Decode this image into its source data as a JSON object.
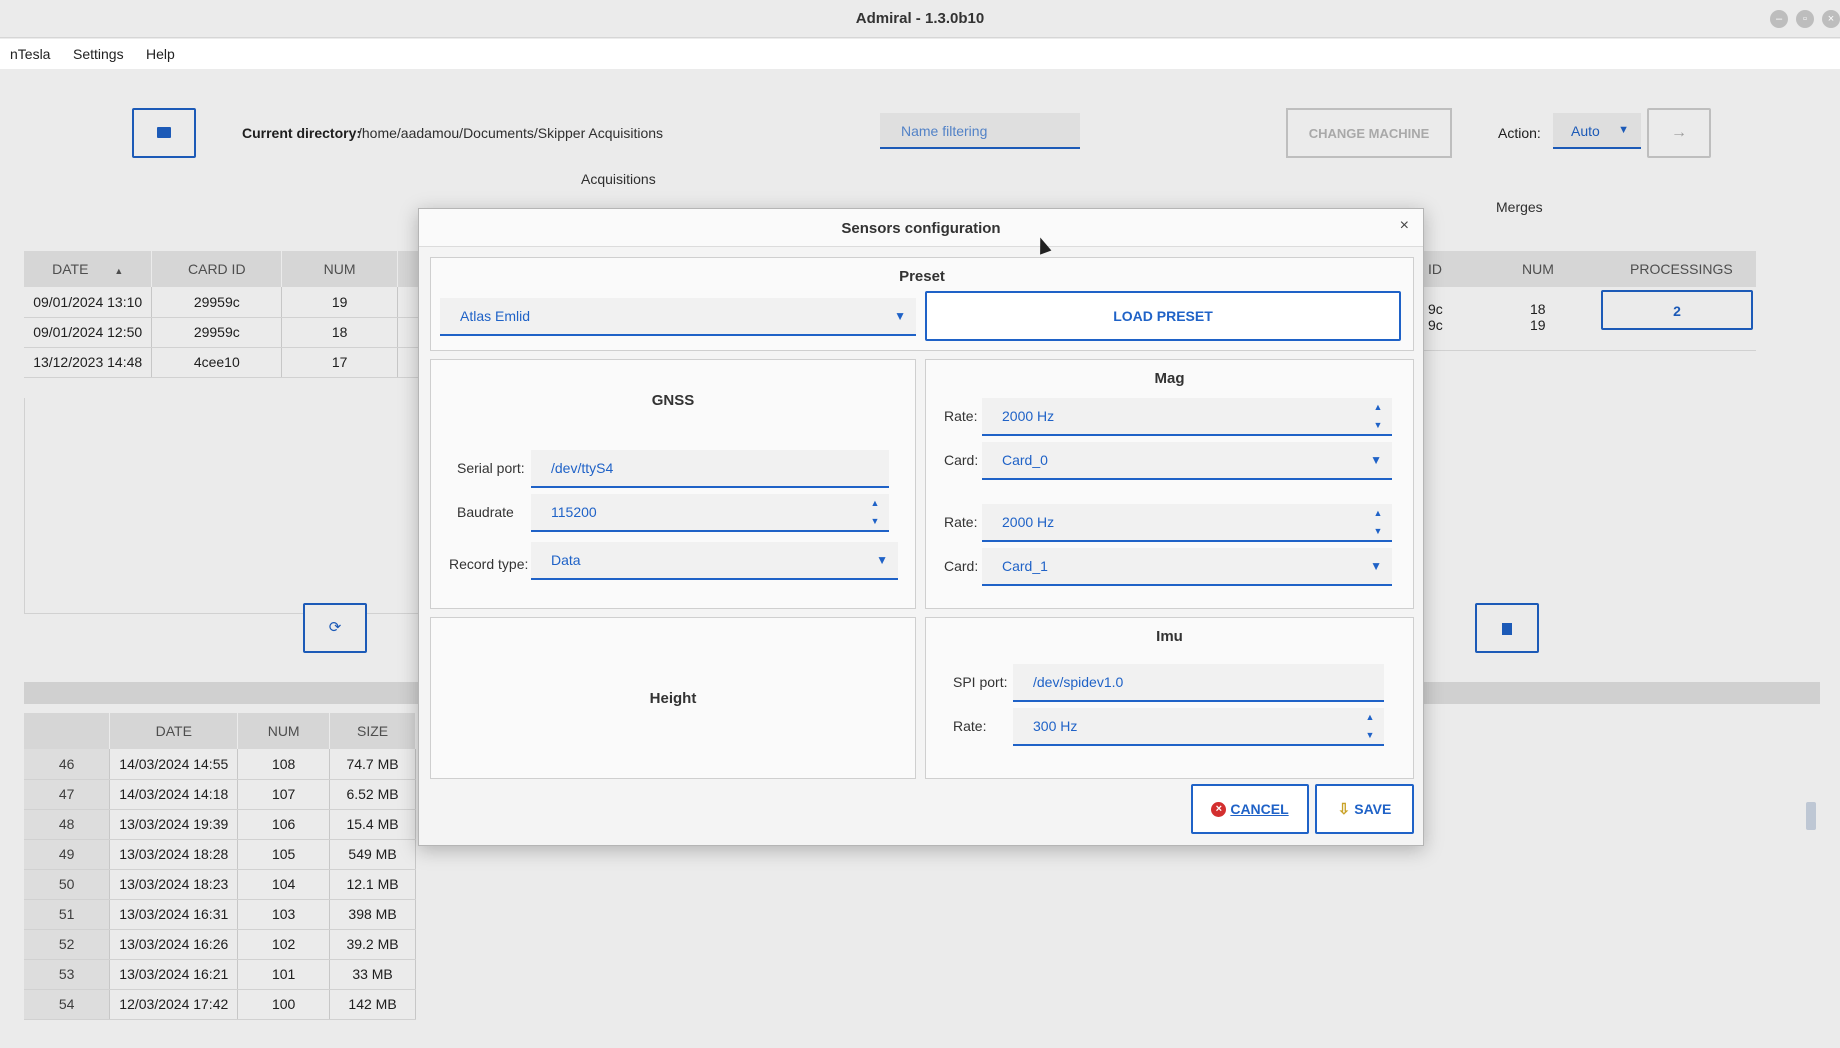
{
  "window": {
    "title": "Admiral - 1.3.0b10"
  },
  "menu": {
    "items": [
      "nTesla",
      "Settings",
      "Help"
    ]
  },
  "toolbar": {
    "current_dir_label": "Current directory:",
    "current_dir_value": "/home/aadamou/Documents/Skipper Acquisitions",
    "name_filter_placeholder": "Name filtering",
    "change_machine": "CHANGE MACHINE",
    "action_label": "Action:",
    "action_value": "Auto"
  },
  "acquisitions": {
    "title": "Acquisitions",
    "headers": [
      "DATE",
      "CARD ID",
      "NUM"
    ],
    "rows": [
      [
        "09/01/2024 13:10",
        "29959c",
        "19"
      ],
      [
        "09/01/2024 12:50",
        "29959c",
        "18"
      ],
      [
        "13/12/2023 14:48",
        "4cee10",
        "17"
      ]
    ]
  },
  "merges": {
    "title": "Merges",
    "headers": [
      "ID",
      "NUM",
      "PROCESSINGS"
    ],
    "id_fragments": [
      "9c",
      "9c"
    ],
    "nums": [
      "18",
      "19"
    ],
    "processings": "2"
  },
  "files": {
    "headers": [
      "",
      "DATE",
      "NUM",
      "SIZE"
    ],
    "rows": [
      [
        "46",
        "14/03/2024 14:55",
        "108",
        "74.7 MB"
      ],
      [
        "47",
        "14/03/2024 14:18",
        "107",
        "6.52 MB"
      ],
      [
        "48",
        "13/03/2024 19:39",
        "106",
        "15.4 MB"
      ],
      [
        "49",
        "13/03/2024 18:28",
        "105",
        "549 MB"
      ],
      [
        "50",
        "13/03/2024 18:23",
        "104",
        "12.1 MB"
      ],
      [
        "51",
        "13/03/2024 16:31",
        "103",
        "398 MB"
      ],
      [
        "52",
        "13/03/2024 16:26",
        "102",
        "39.2 MB"
      ],
      [
        "53",
        "13/03/2024 16:21",
        "101",
        "33 MB"
      ],
      [
        "54",
        "12/03/2024 17:42",
        "100",
        "142 MB"
      ]
    ]
  },
  "dialog": {
    "title": "Sensors configuration",
    "preset": {
      "title": "Preset",
      "selected": "Atlas Emlid",
      "load_button": "LOAD PRESET"
    },
    "gnss": {
      "title": "GNSS",
      "serial_port_label": "Serial port:",
      "serial_port_value": "/dev/ttyS4",
      "baudrate_label": "Baudrate",
      "baudrate_value": "115200",
      "record_type_label": "Record type:",
      "record_type_value": "Data"
    },
    "mag": {
      "title": "Mag",
      "rate_label": "Rate:",
      "card_label": "Card:",
      "rate1": "2000 Hz",
      "card1": "Card_0",
      "rate2": "2000 Hz",
      "card2": "Card_1"
    },
    "height": {
      "title": "Height"
    },
    "imu": {
      "title": "Imu",
      "spi_port_label": "SPI port:",
      "spi_port_value": "/dev/spidev1.0",
      "rate_label": "Rate:",
      "rate_value": "300 Hz"
    },
    "cancel": "CANCEL",
    "save": "SAVE"
  },
  "colors": {
    "accent": "#1f62c7",
    "cancel_icon": "#d32f2f",
    "save_icon": "#c9a227"
  }
}
